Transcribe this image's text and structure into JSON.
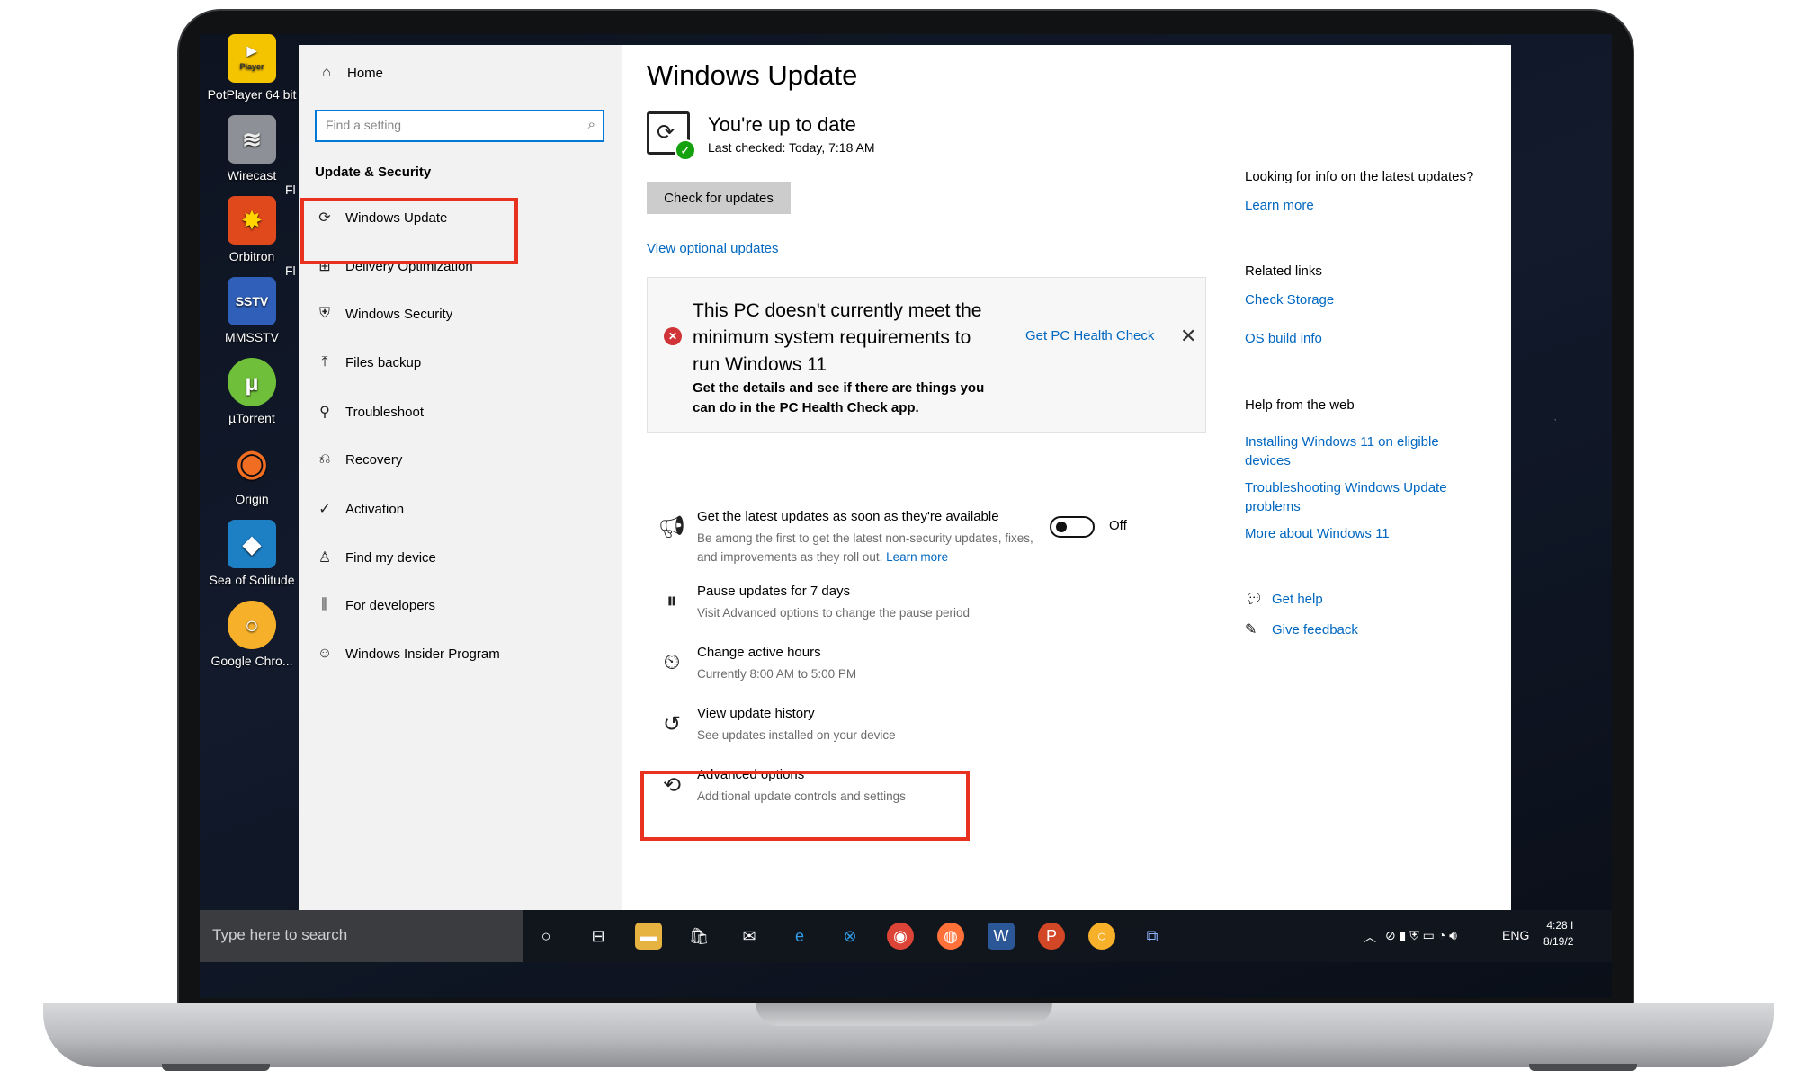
{
  "desktop": {
    "icons": [
      {
        "label": "PotPlayer 64 bit",
        "badge": "Player",
        "color": "#f5c400"
      },
      {
        "label": "Wirecast",
        "color": "#8d9096"
      },
      {
        "label": "Orbitron",
        "color": "#e0491b"
      },
      {
        "label": "MMSSTV",
        "badge": "SSTV",
        "color": "#2f5fb8"
      },
      {
        "label": "µTorrent",
        "color": "#6fbf3a"
      },
      {
        "label": "Origin",
        "color": "#f06d22"
      },
      {
        "label": "Sea of Solitude",
        "color": "#1d7fc4"
      },
      {
        "label": "Google Chro...",
        "color": "#f6b02a"
      }
    ],
    "partial_labels": [
      "Fl",
      "Fl"
    ]
  },
  "sidebar": {
    "home": "Home",
    "search_placeholder": "Find a setting",
    "section_title": "Update & Security",
    "items": [
      {
        "label": "Windows Update",
        "icon": "sync-icon"
      },
      {
        "label": "Delivery Optimization",
        "icon": "delivery-icon"
      },
      {
        "label": "Windows Security",
        "icon": "shield-icon"
      },
      {
        "label": "Files backup",
        "icon": "backup-icon"
      },
      {
        "label": "Troubleshoot",
        "icon": "wrench-icon"
      },
      {
        "label": "Recovery",
        "icon": "recovery-icon"
      },
      {
        "label": "Activation",
        "icon": "check-circle-icon"
      },
      {
        "label": "Find my device",
        "icon": "person-icon"
      },
      {
        "label": "For developers",
        "icon": "sliders-icon"
      },
      {
        "label": "Windows Insider Program",
        "icon": "insider-icon"
      }
    ]
  },
  "main": {
    "title": "Windows Update",
    "status_title": "You're up to date",
    "status_sub": "Last checked: Today, 7:18 AM",
    "check_button": "Check for updates",
    "optional_link": "View optional updates",
    "notice": {
      "title": "This PC doesn't currently meet the minimum system requirements to run Windows 11",
      "body": "Get the details and see if there are things you can do in the PC Health Check app.",
      "link": "Get PC Health Check"
    },
    "options": [
      {
        "title": "Get the latest updates as soon as they're available",
        "sub": "Be among the first to get the latest non-security updates, fixes, and improvements as they roll out.",
        "sub_link": "Learn more",
        "toggle": "Off"
      },
      {
        "title": "Pause updates for 7 days",
        "sub": "Visit Advanced options to change the pause period"
      },
      {
        "title": "Change active hours",
        "sub": "Currently 8:00 AM to 5:00 PM"
      },
      {
        "title": "View update history",
        "sub": "See updates installed on your device"
      },
      {
        "title": "Advanced options",
        "sub": "Additional update controls and settings"
      }
    ]
  },
  "right": {
    "info_text": "Looking for info on the latest updates?",
    "info_link": "Learn more",
    "related_title": "Related links",
    "related_links": [
      "Check Storage",
      "OS build info"
    ],
    "help_title": "Help from the web",
    "help_links": [
      "Installing Windows 11 on eligible devices",
      "Troubleshooting Windows Update problems",
      "More about Windows 11"
    ],
    "get_help": "Get help",
    "give_feedback": "Give feedback"
  },
  "taskbar": {
    "search_placeholder": "Type here to search",
    "language": "ENG",
    "time": "4:28 I",
    "date": "8/19/2"
  },
  "colors": {
    "accent": "#0067c0",
    "highlight": "#e8311e",
    "success": "#13a10e",
    "error": "#d13438"
  }
}
